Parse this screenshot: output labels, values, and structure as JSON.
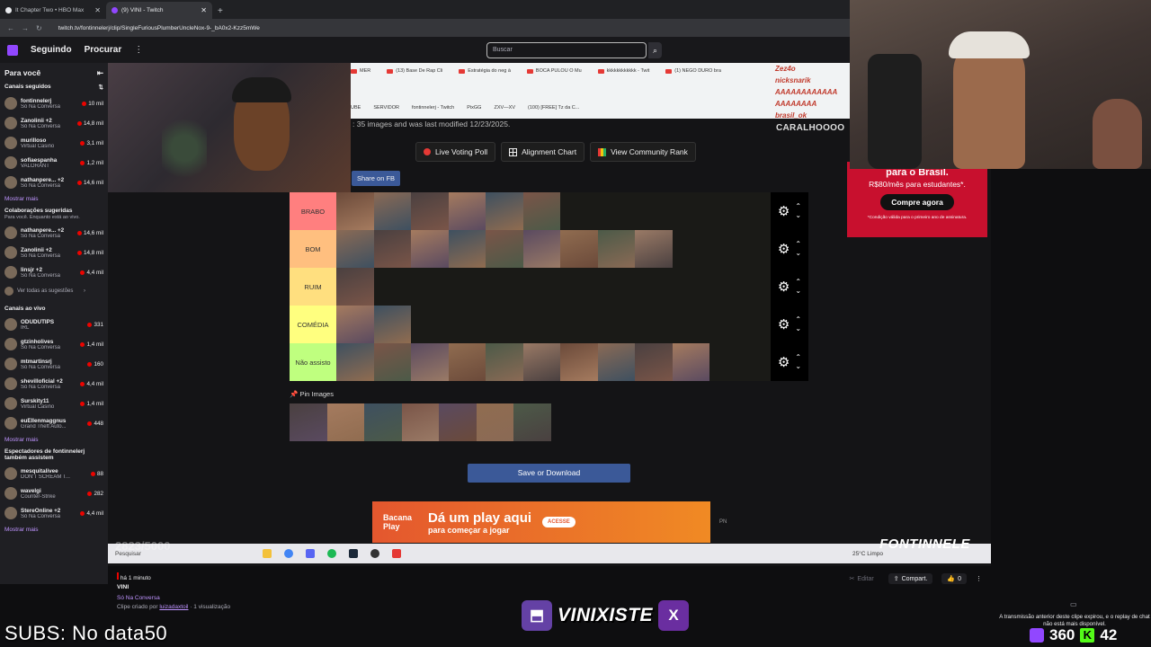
{
  "browser": {
    "tabs": [
      {
        "label": "It Chapter Two • HBO Max",
        "active": false
      },
      {
        "label": "(9) VINI - Twitch",
        "active": true
      }
    ],
    "new_tab": "+",
    "url": "twitch.tv/fontinnelerj/clip/SingleFuriousPlumberUncleNox-9-_bA0x2-Kzz5mWe"
  },
  "topnav": {
    "following": "Seguindo",
    "browse": "Procurar",
    "search_placeholder": "Buscar"
  },
  "sidebar": {
    "header": "Para você",
    "followed_title": "Canais seguidos",
    "followed": [
      {
        "name": "fontinnelerj",
        "game": "Só Na Conversa",
        "count": "10 mil"
      },
      {
        "name": "Zanolinii +2",
        "game": "Só Na Conversa",
        "count": "14,8 mil"
      },
      {
        "name": "murilloso",
        "game": "Virtual Casino",
        "count": "3,1 mil"
      },
      {
        "name": "sofiaespanha",
        "game": "VALORANT",
        "count": "1,2 mil"
      },
      {
        "name": "nathanpere... +2",
        "game": "Só Na Conversa",
        "count": "14,6 mil"
      }
    ],
    "show_more": "Mostrar mais",
    "suggested_title": "Colaborações sugeridas",
    "suggested_sub": "Para você. Enquanto está ao vivo.",
    "suggested": [
      {
        "name": "nathanpere... +2",
        "game": "Só Na Conversa",
        "count": "14,6 mil"
      },
      {
        "name": "Zanolinii +2",
        "game": "Só Na Conversa",
        "count": "14,8 mil"
      },
      {
        "name": "linsjr +2",
        "game": "Só Na Conversa",
        "count": "4,4 mil"
      }
    ],
    "see_all": "Ver todas as sugestões",
    "live_title": "Canais ao vivo",
    "live": [
      {
        "name": "ODUDUTIPS",
        "game": "IRL",
        "count": "331"
      },
      {
        "name": "gtzinholives",
        "game": "Só Na Conversa",
        "count": "1,4 mil"
      },
      {
        "name": "mtmartinsrj",
        "game": "Só Na Conversa",
        "count": "160"
      },
      {
        "name": "shevilloficial +2",
        "game": "Só Na Conversa",
        "count": "4,4 mil"
      },
      {
        "name": "Surskity11",
        "game": "Virtual Casino",
        "count": "1,4 mil"
      },
      {
        "name": "euEllenmaggnus",
        "game": "Grand Theft Auto...",
        "count": "448"
      }
    ],
    "show_more_2": "Mostrar mais",
    "viewers_title": "Espectadores de fontinnelerj também assistem",
    "viewers": [
      {
        "name": "mesquitalivee",
        "game": "DON'T SCREAM T...",
        "count": "88"
      },
      {
        "name": "wavelgi",
        "game": "Counter-Strike",
        "count": "282"
      },
      {
        "name": "StereOnline +2",
        "game": "Só Na Conversa",
        "count": "4,4 mil"
      }
    ],
    "show_more_3": "Mostrar mais"
  },
  "inner_browser": {
    "tabs": [
      "MER",
      "(13) Base De Rap Cli",
      "Estratégia do neg à",
      "BOCA PULOU O Mu",
      "kkkkkkkkkkkk - Twit",
      "(1) NEGO DURO bra"
    ],
    "bookmarks": [
      "UBE",
      "SERVIDOR",
      "fontinnelerj - Twitch",
      "PixGG",
      "ZXV—XV",
      "(100) [FREE] Tz da C..."
    ]
  },
  "chat_overlay": [
    "Zez4o",
    "nicksnarik",
    "AAAAAAAAAAAA",
    "AAAAAAAA",
    "brasil_ok"
  ],
  "carala": "CARALHOOOO",
  "tierpage": {
    "subtitle": ": 35 images and was last modified 12/23/2025.",
    "live_voting": "Live Voting Poll",
    "alignment": "Alignment Chart",
    "community": "View Community Rank",
    "share": "Share on FB",
    "tiers": [
      {
        "label": "BRABO",
        "color": "#ff7f7f",
        "count": 6
      },
      {
        "label": "BOM",
        "color": "#ffbf7f",
        "count": 9
      },
      {
        "label": "RUIM",
        "color": "#ffdf7f",
        "count": 1
      },
      {
        "label": "COMÉDIA",
        "color": "#ffff7f",
        "count": 2
      },
      {
        "label": "Não assisto",
        "color": "#bfff7f",
        "count": 10
      }
    ],
    "pin_label": "Pin Images",
    "pin_count": 7,
    "save": "Save or Download"
  },
  "ads": {
    "bottom_logo": "Bacana Play",
    "bottom_main": "Dá um play aqui",
    "bottom_sub": "para começar a jogar",
    "bottom_cta": "ACESSE",
    "bottom_pn": "PN",
    "right_title": "para o Brasil.",
    "right_price": "R$80/mês para estudantes*.",
    "right_cta": "Compre agora",
    "right_note": "*Condição válida para o primeiro ano de assinatura."
  },
  "taskbar": {
    "search": "Pesquisar",
    "weather": "25°C Limpo"
  },
  "faint_count": "2823/5000",
  "fontinnele": "FONTINNELE",
  "clip": {
    "time": "há 1 minuto",
    "title": "VINI",
    "game": "Só Na Conversa",
    "meta_prefix": "Clipe criado por",
    "creator": "luizadaxtoil",
    "meta_suffix": "· 1 visualização",
    "edit": "Editar",
    "share": "Compart.",
    "likes": "0"
  },
  "right_note": "A transmissão anterior deste clipe expirou, e o replay de chat não está mais disponível.",
  "overlay": {
    "subs": "SUBS: No data50",
    "channel": "VINIXISTE",
    "viewers_twitch": "360",
    "viewers_kick": "42"
  },
  "colors": {
    "twitch_purple": "#9147ff",
    "live_red": "#eb0400",
    "fb_blue": "#3b5998",
    "kick_green": "#53fc18"
  }
}
